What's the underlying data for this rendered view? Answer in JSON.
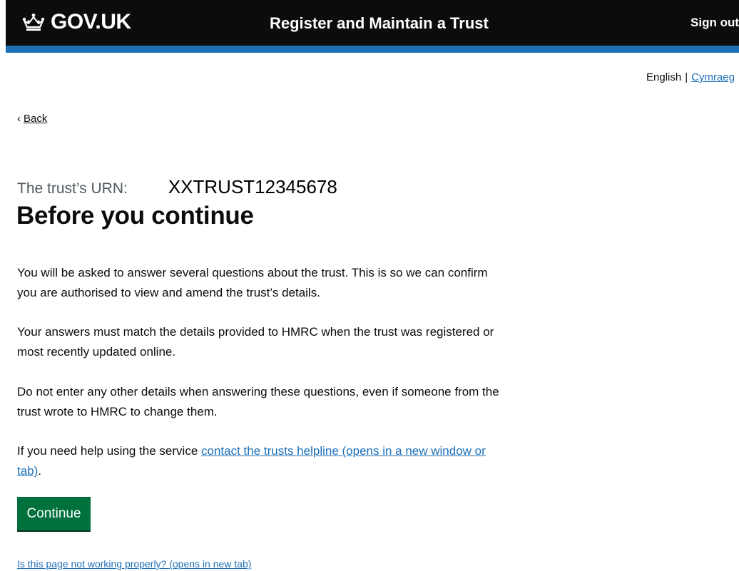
{
  "header": {
    "logo_text": "GOV.UK",
    "service_name": "Register and Maintain a Trust",
    "sign_out": "Sign out",
    "background": "#0b0c0c",
    "stripe_color": "#1d70b8"
  },
  "language": {
    "current": "English",
    "separator": "|",
    "other": "Cymraeg"
  },
  "nav": {
    "back_icon": "chevron-left-icon",
    "back_label": "Back"
  },
  "main": {
    "caption": "The trust’s URN:",
    "urn": "XXTRUST12345678",
    "heading": "Before you continue",
    "paragraphs": [
      "You will be asked to answer several questions about the trust. This is so we can confirm you are authorised to view and amend the trust’s details.",
      "Your answers must match the details provided to HMRC when the trust was registered or most recently updated online.",
      "Do not enter any other details when answering these questions, even if someone from the trust wrote to HMRC to change them."
    ],
    "help_prefix": "If you need help using the service ",
    "help_link": "contact the trusts helpline (opens in a new window or tab)",
    "help_suffix": ".",
    "continue_label": "Continue",
    "continue_color": "#00703c"
  },
  "footer": {
    "report_link": "Is this page not working properly? (opens in new tab)"
  }
}
